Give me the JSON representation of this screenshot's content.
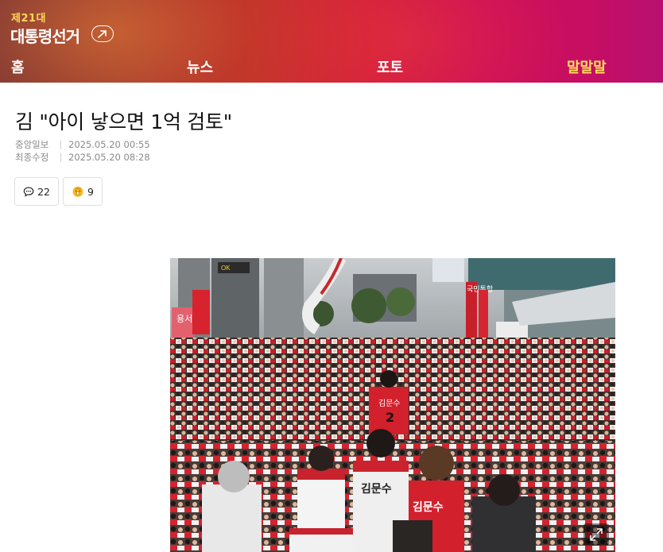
{
  "header": {
    "edition": "제21대",
    "title": "대통령선거",
    "nav": [
      {
        "label": "홈"
      },
      {
        "label": "뉴스"
      },
      {
        "label": "포토"
      },
      {
        "label": "말말말"
      }
    ],
    "active_nav": "말말말",
    "active_color": "#ffe15a"
  },
  "article": {
    "headline": "김 \"아이 낳으면 1억 검토\"",
    "source_label": "중앙일보",
    "published": "2025.05.20 00:55",
    "modified_label": "최종수정",
    "modified": "2025.05.20 08:28",
    "comment_count": "22",
    "reaction_count": "9",
    "photo": {
      "description_icon": "campaign-rally-photo",
      "shirt_text_1": "김문수",
      "shirt_text_2": "김문수",
      "shirt_text_3": "김문수",
      "shirt_number": "2",
      "banner_1": "용서는",
      "banner_2": "국민통합",
      "expand_icon": "expand-icon"
    }
  }
}
